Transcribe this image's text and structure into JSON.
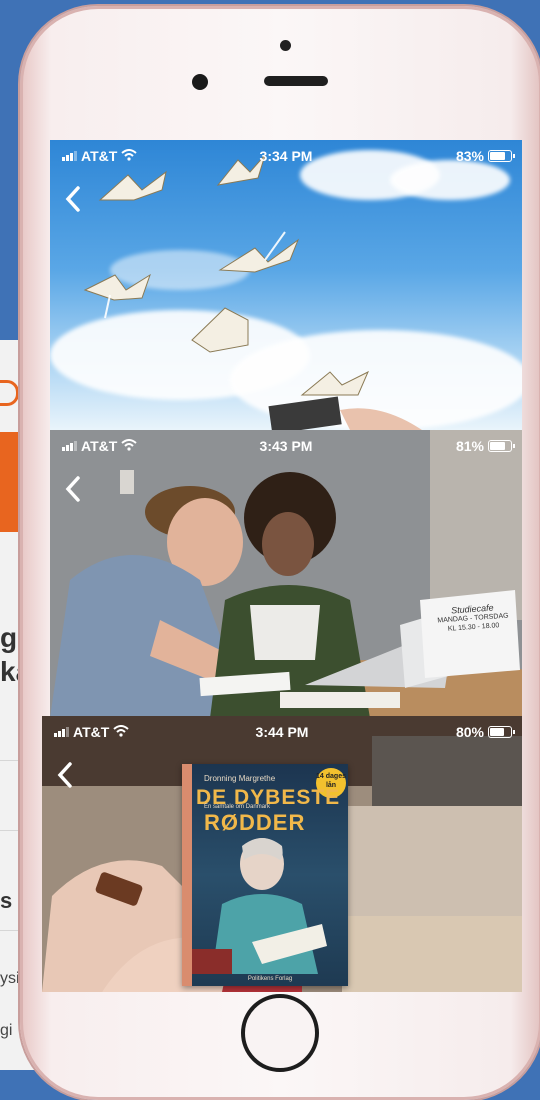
{
  "background_card": {
    "fragment_1": "g",
    "fragment_2": "ka",
    "fragment_3": "s",
    "fragment_4": "ysi",
    "fragment_5": "gi"
  },
  "screens": [
    {
      "carrier": "AT&T",
      "time": "3:34 PM",
      "battery": "83%",
      "battery_level": 0.83
    },
    {
      "carrier": "AT&T",
      "time": "3:43 PM",
      "battery": "81%",
      "battery_level": 0.81
    },
    {
      "carrier": "AT&T",
      "time": "3:44 PM",
      "battery": "80%",
      "battery_level": 0.8
    }
  ],
  "book": {
    "badge": "14 dages lån",
    "author": "Dronning Margrethe",
    "title_line1": "DE DYBESTE",
    "title_line2": "RØDDER",
    "subtitle": "En samtale om Danmark",
    "publisher": "Politikens Forlag"
  },
  "sign": {
    "line1": "Studiecafe",
    "line2": "MANDAG - TORSDAG",
    "line3": "KL 15.30 - 18.00"
  },
  "colors": {
    "accent": "#e8651f",
    "frame": "#3f72b6"
  }
}
